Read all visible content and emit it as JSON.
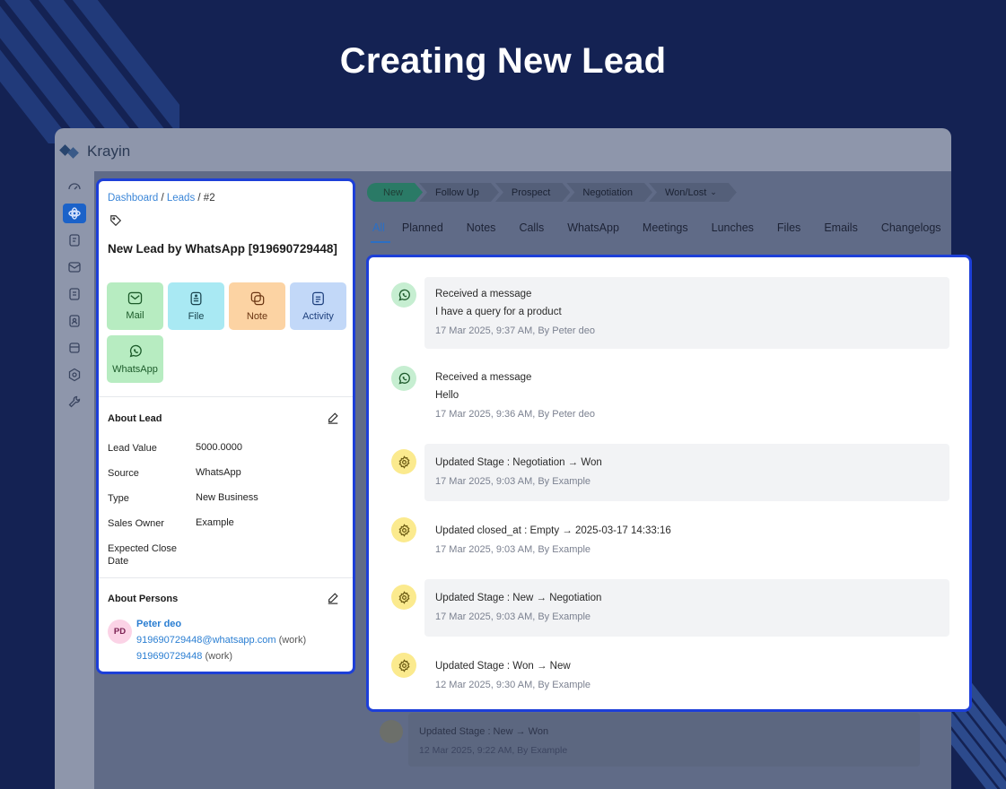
{
  "headline": "Creating New Lead",
  "app": {
    "logo_text": "Krayin"
  },
  "sidebar": {
    "icons": [
      "dashboard-icon",
      "leads-icon",
      "quotes-icon",
      "mail-icon",
      "activities-icon",
      "contacts-icon",
      "products-icon",
      "settings-icon",
      "configuration-icon"
    ],
    "active": "leads-icon"
  },
  "stages": [
    "New",
    "Follow Up",
    "Prospect",
    "Negotiation",
    "Won/Lost"
  ],
  "tabs": [
    "All",
    "Planned",
    "Notes",
    "Calls",
    "WhatsApp",
    "Meetings",
    "Lunches",
    "Files",
    "Emails",
    "Changelogs"
  ],
  "lead": {
    "breadcrumb": {
      "dashboard": "Dashboard",
      "sep1": " / ",
      "leads": "Leads",
      "sep2": " / ",
      "current": "#2"
    },
    "title": "New Lead by WhatsApp [919690729448]",
    "actions": {
      "mail": "Mail",
      "file": "File",
      "note": "Note",
      "activity": "Activity",
      "whatsapp": "WhatsApp"
    },
    "about_lead": {
      "title": "About Lead",
      "attributes": [
        {
          "label": "Lead Value",
          "value": "5000.0000"
        },
        {
          "label": "Source",
          "value": "WhatsApp"
        },
        {
          "label": "Type",
          "value": "New Business"
        },
        {
          "label": "Sales Owner",
          "value": "Example"
        },
        {
          "label": "Expected Close Date",
          "value": ""
        }
      ]
    },
    "about_persons": {
      "title": "About Persons",
      "person": {
        "initials": "PD",
        "name": "Peter deo",
        "email": "919690729448@whatsapp.com",
        "email_tag": "(work)",
        "phone": "919690729448",
        "phone_tag": "(work)"
      }
    }
  },
  "activities": [
    {
      "icon": "whatsapp-icon",
      "title": "Received a message",
      "body": "I have a query for a product",
      "meta": "17 Mar 2025, 9:37 AM, By Peter deo"
    },
    {
      "icon": "whatsapp-icon",
      "title": "Received a message",
      "body": "Hello",
      "meta": "17 Mar 2025, 9:36 AM, By Peter deo"
    },
    {
      "icon": "gear-icon",
      "title": "Updated Stage : Negotiation → Won",
      "meta": "17 Mar 2025, 9:03 AM, By Example"
    },
    {
      "icon": "gear-icon",
      "title": "Updated closed_at : Empty → 2025-03-17 14:33:16",
      "meta": "17 Mar 2025, 9:03 AM, By Example"
    },
    {
      "icon": "gear-icon",
      "title": "Updated Stage : New → Negotiation",
      "meta": "17 Mar 2025, 9:03 AM, By Example"
    },
    {
      "icon": "gear-icon",
      "title": "Updated Stage : Won → New",
      "meta": "12 Mar 2025, 9:30 AM, By Example"
    }
  ],
  "background_activity": {
    "title": "Updated Stage : New → Won",
    "meta": "12 Mar 2025, 9:22 AM, By Example"
  },
  "colors": {
    "page_bg": "#142253",
    "highlight_border": "#1d3fd8",
    "link": "#2a7ed2"
  }
}
